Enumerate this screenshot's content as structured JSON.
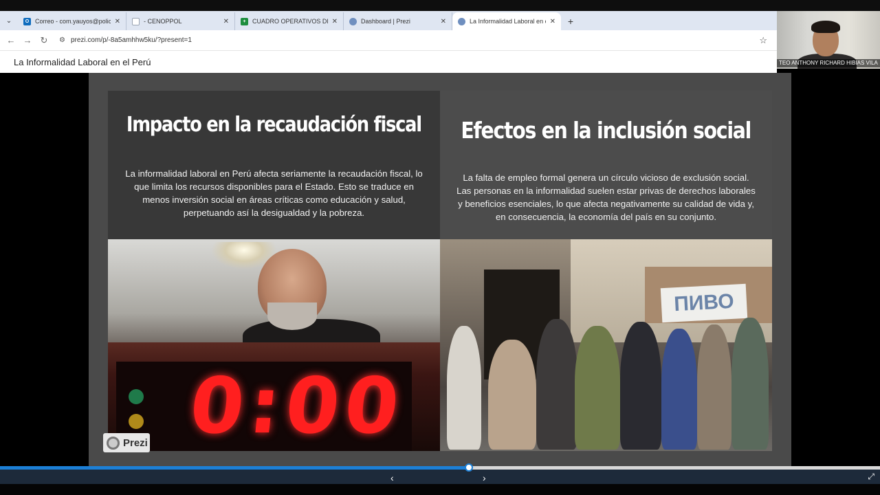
{
  "browser": {
    "tabs": [
      {
        "title": "Correo - com.yauyos@policia.g",
        "icon": "outlook-icon",
        "color": "#0f6cbd"
      },
      {
        "title": "- CENOPPOL",
        "icon": "page-icon",
        "color": "#9aa4b2"
      },
      {
        "title": "CUADRO OPERATIVOS DIARIO",
        "icon": "sheets-icon",
        "color": "#1e8e3e"
      },
      {
        "title": "Dashboard | Prezi",
        "icon": "prezi-icon",
        "color": "#6f8fbf"
      },
      {
        "title": "La Informalidad Laboral en el Pe",
        "icon": "prezi-icon",
        "color": "#6f8fbf"
      }
    ],
    "new_tab": "+",
    "close_glyph": "✕",
    "url": "prezi.com/p/-8a5amhhw5ku/?present=1"
  },
  "page": {
    "title": "La Informalidad Laboral en el Perú"
  },
  "video_call": {
    "participant_name": "TEO ANTHONY RICHARD HIBIAS VILA"
  },
  "slide": {
    "left": {
      "heading": "Impacto en la recaudación fiscal",
      "body": "La informalidad laboral en Perú afecta seriamente la recaudación fiscal, lo que limita los recursos disponibles para el Estado. Esto se traduce en menos inversión social en áreas críticas como educación y salud, perpetuando así la desigualdad y la pobreza.",
      "photo_clock": "0:00"
    },
    "right": {
      "heading": "Efectos en la inclusión social",
      "body": "La falta de empleo formal genera un círculo vicioso de exclusión social. Las personas en la informalidad suelen estar privas de derechos laborales y beneficios esenciales, lo que afecta negativamente su calidad de vida y, en consecuencia, la economía del país en su conjunto.",
      "photo_sign": "ПИВО"
    }
  },
  "player": {
    "progress": 0.533,
    "brand": "Prezi",
    "accent": "#1c7fd6"
  }
}
